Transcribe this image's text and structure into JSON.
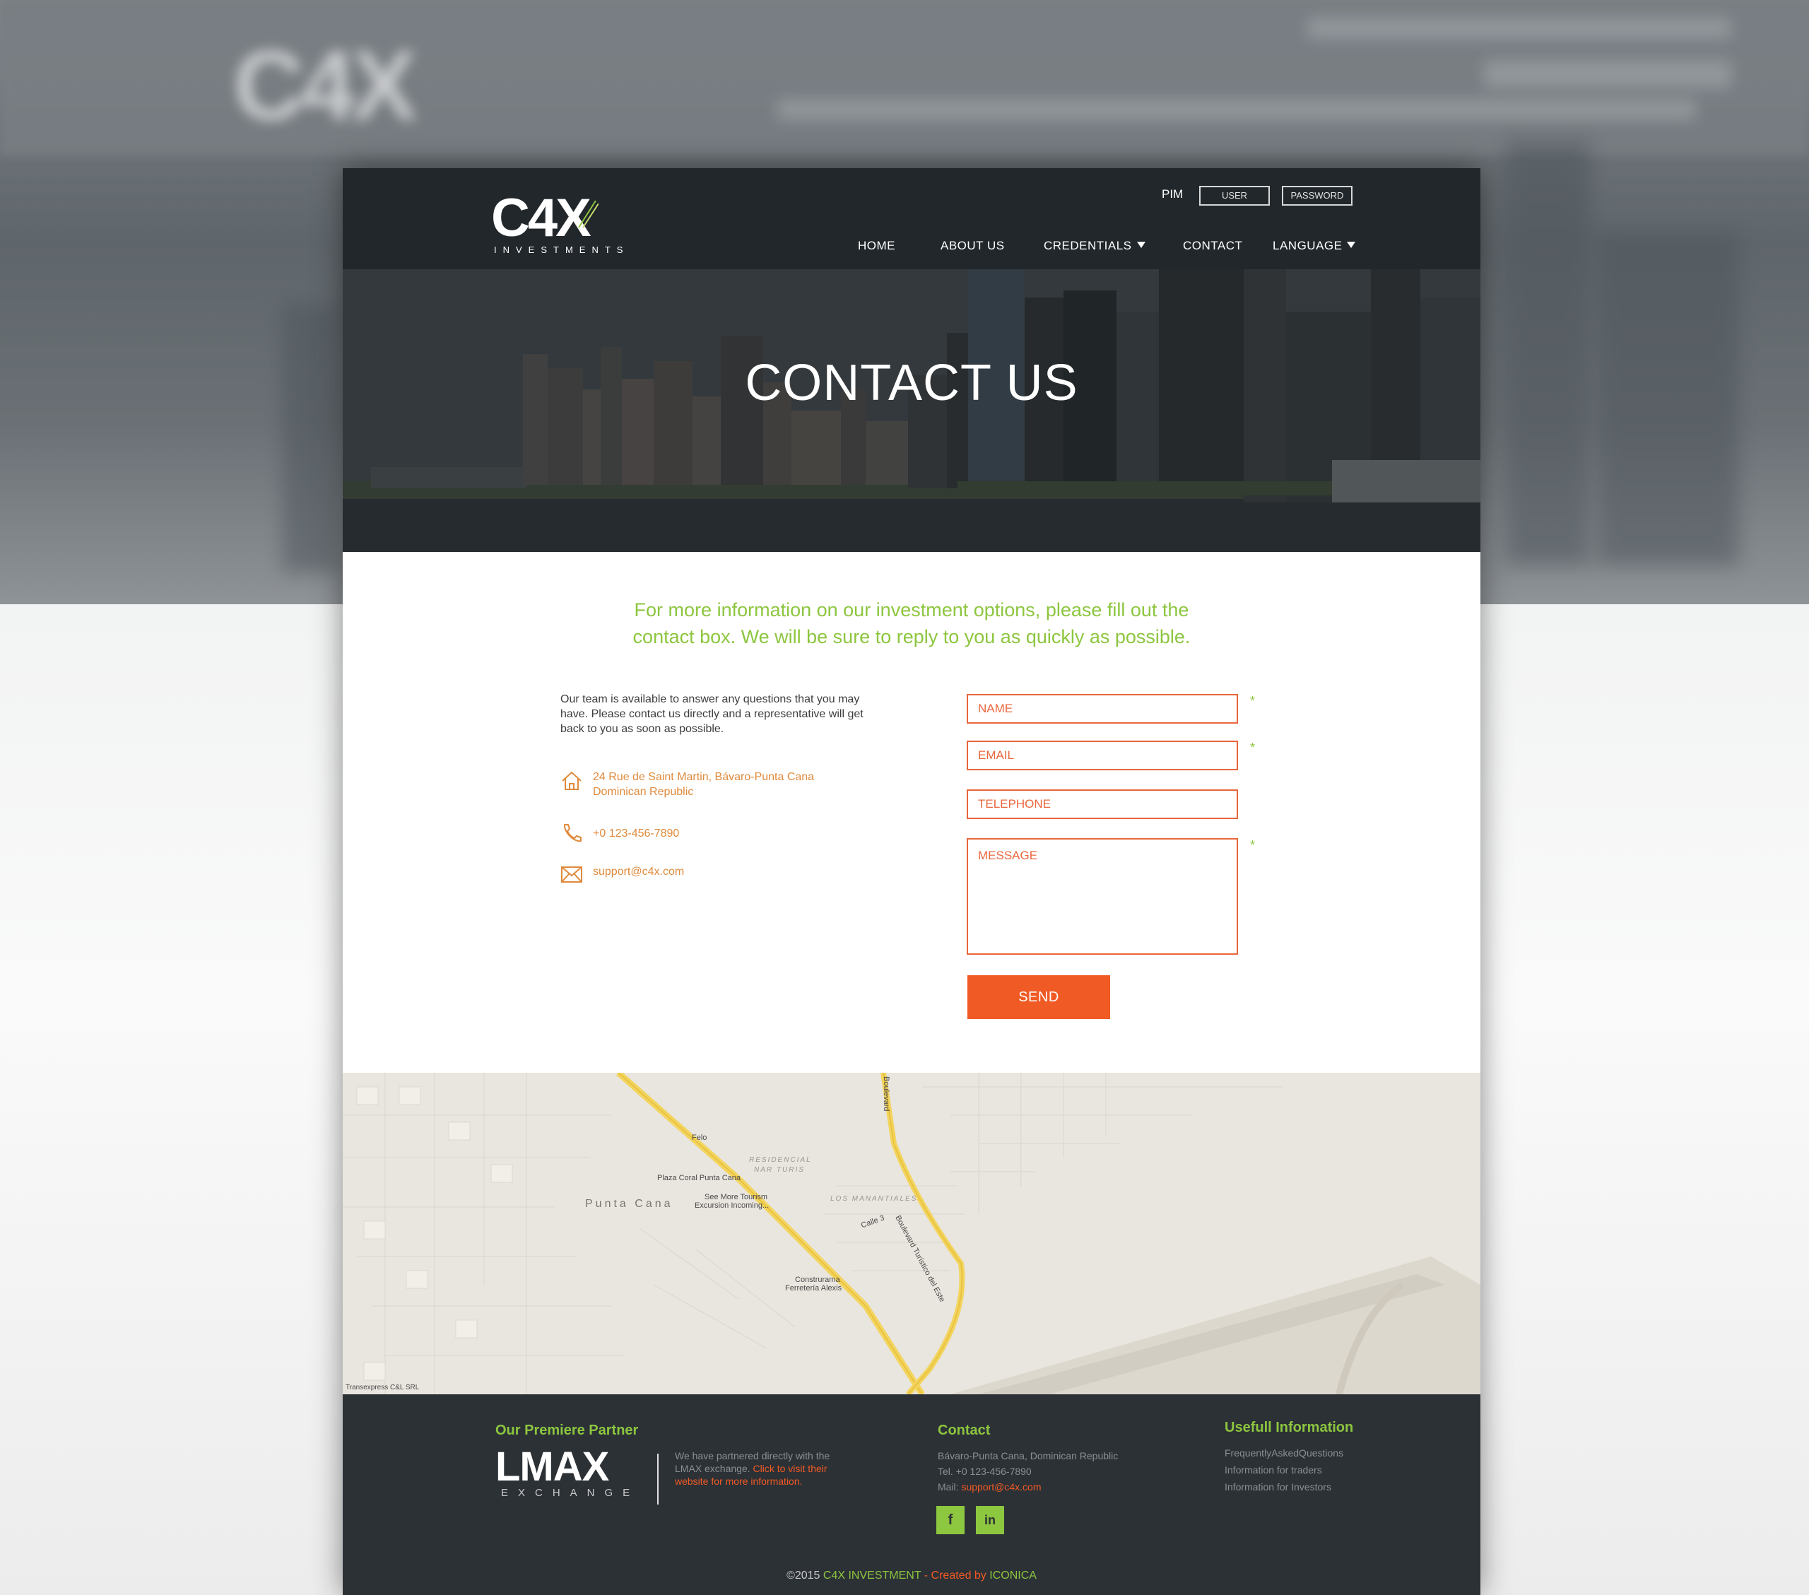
{
  "header": {
    "logo_main": "C4X",
    "logo_sub": "INVESTMENTS",
    "login_label": "PIM",
    "user_placeholder": "USER",
    "password_placeholder": "PASSWORD",
    "nav": {
      "home": "HOME",
      "about": "ABOUT US",
      "credentials": "CREDENTIALS",
      "contact": "CONTACT",
      "language": "LANGUAGE"
    }
  },
  "hero": {
    "title": "CONTACT US"
  },
  "intro": "For more information on our investment options, please fill out the contact box. We will be sure to reply to you as quickly as possible.",
  "info": {
    "text": "Our team is available to answer any questions that you may have. Please contact us directly and a representative will get back to you as soon as possible.",
    "address_line1": "24 Rue de Saint Martin, Bávaro-Punta Cana",
    "address_line2": "Dominican Republic",
    "phone": "+0 123-456-7890",
    "email": "support@c4x.com",
    "icons": [
      "home-icon",
      "phone-icon",
      "mail-icon"
    ]
  },
  "form": {
    "name_placeholder": "NAME",
    "email_placeholder": "EMAIL",
    "telephone_placeholder": "TELEPHONE",
    "message_placeholder": "MESSAGE",
    "required_mark": "*",
    "send_label": "SEND"
  },
  "map": {
    "town": "Punta Cana",
    "district1_line1": "RESIDENCIAL",
    "district1_line2": "NAR TURIS",
    "district2": "LOS MANANTIALES",
    "poi_felo": "Felo",
    "poi_plaza": "Plaza Coral Punta Cana",
    "poi_tour1": "See More Tourism",
    "poi_tour2": "Excursion Incoming...",
    "poi_const1": "Construrama",
    "poi_const2": "Ferretería Alexis",
    "road1": "Boulevard Turístico del Este",
    "road2": "Boulevard",
    "street": "Calle 3",
    "attribution": "Transexpress C&L SRL"
  },
  "footer": {
    "partner_heading": "Our Premiere Partner",
    "partner_logo_main": "LMAX",
    "partner_logo_sub": "EXCHANGE",
    "partner_text1": "We have partnered directly with the",
    "partner_text2": "LMAX exchange.",
    "partner_link1": "Click to visit their",
    "partner_link2": "website for more information.",
    "contact_heading": "Contact",
    "contact_address": "Bávaro-Punta Cana, Dominican Republic",
    "contact_tel": "Tel. +0 123-456-7890",
    "contact_mail_label": "Mail:",
    "contact_mail": "support@c4x.com",
    "social_fb": "f",
    "social_in": "in",
    "useful_heading": "Usefull Information",
    "useful_links": [
      "FrequentlyAskedQuestions",
      "Information for traders",
      "Information for Investors"
    ],
    "copy_prefix": "©2015",
    "copy_brand": "C4X INVESTMENT",
    "copy_mid": "- Created by",
    "copy_agency": "ICONICA"
  },
  "colors": {
    "accent_green": "#8dc63f",
    "accent_orange": "#f05a24",
    "header_bg": "#22272b",
    "footer_bg": "#2c3136"
  }
}
